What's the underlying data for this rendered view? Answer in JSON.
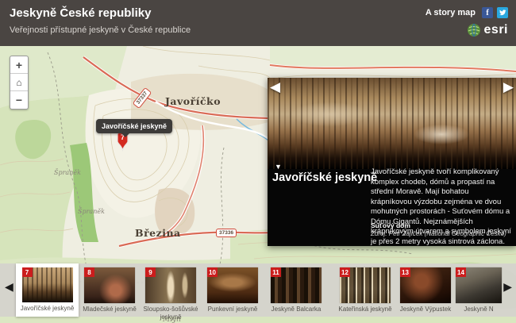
{
  "header": {
    "title": "Jeskyně České republiky",
    "subtitle": "Veřejnosti přístupné jeskyně v České republice",
    "story_map_label": "A story map",
    "facebook_glyph": "f",
    "esri_label": "esri"
  },
  "icons": {
    "zoom_in": "+",
    "home": "⌂",
    "zoom_out": "−",
    "prev": "◀",
    "next": "▶",
    "collapse": "▼"
  },
  "map": {
    "labels": {
      "javoricko": "Javoříčko",
      "brezina": "Březina",
      "spranek1": "Špraněk",
      "spranek2": "Špraněk",
      "mlyn": "Mlýn",
      "road1": "37337",
      "road2": "37336"
    },
    "marker": {
      "number": "7",
      "tooltip": "Javoříčské jeskyně"
    }
  },
  "popup": {
    "title": "Javoříčské jeskyně",
    "description": "Javoříčské jeskyně tvoří komplikovaný komplex chodeb, dómů a propastí na střední Moravě. Mají bohatou krápníkovou výzdobu zejména ve dvou mohutných prostorách - Suťovém dómu a Dómu Gigantů. Nejznámějších krápníkovým útvarem a symbolem jeskyní je přes 2 metry vysoká sintrová záclona.",
    "caption": "Suťový dóm",
    "source": "Zdroj: Petr Zajíček (National Geographic Česko)"
  },
  "carousel": {
    "items": [
      {
        "number": "7",
        "label": "Javoříčské jeskyně",
        "selected": true
      },
      {
        "number": "8",
        "label": "Mladečské jeskyně"
      },
      {
        "number": "9",
        "label": "Sloupsko-šošůvské jeskyně"
      },
      {
        "number": "10",
        "label": "Punkevní jeskyně"
      },
      {
        "number": "11",
        "label": "Jeskyně Balcarka"
      },
      {
        "number": "12",
        "label": "Kateřinská jeskyně"
      },
      {
        "number": "13",
        "label": "Jeskyně Výpustek"
      },
      {
        "number": "14",
        "label": "Jeskyně N"
      }
    ]
  },
  "colors": {
    "header_bg": "#4a4542",
    "badge_red": "#cb1d1d",
    "pin_red": "#d32a20",
    "facebook_blue": "#3a5897",
    "twitter_blue": "#29a8e0",
    "carousel_bg": "#d4d2cc",
    "popup_bg": "#060606"
  }
}
